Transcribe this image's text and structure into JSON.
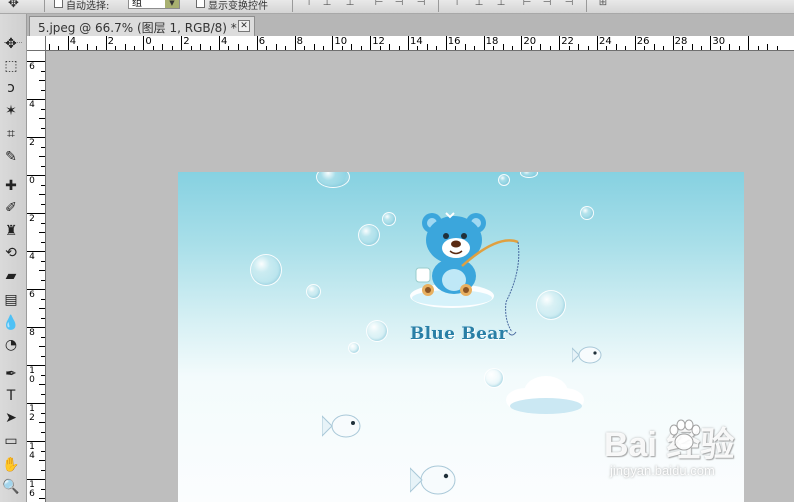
{
  "options_bar": {
    "auto_select_label": "自动选择:",
    "auto_select_value": "组",
    "transform_controls_label": "显示变换控件"
  },
  "document_tab": {
    "title": "5.jpeg @ 66.7% (图层 1, RGB/8) *",
    "close_glyph": "✕"
  },
  "tools": [
    {
      "name": "move-tool-icon",
      "glyph": "✥"
    },
    {
      "name": "marquee-tool-icon",
      "glyph": "⬚"
    },
    {
      "name": "lasso-tool-icon",
      "glyph": "ↄ"
    },
    {
      "name": "magic-wand-tool-icon",
      "glyph": "✶"
    },
    {
      "name": "crop-tool-icon",
      "glyph": "⌗"
    },
    {
      "name": "eyedropper-tool-icon",
      "glyph": "✎"
    },
    {
      "name": "healing-brush-tool-icon",
      "glyph": "✚"
    },
    {
      "name": "brush-tool-icon",
      "glyph": "✐"
    },
    {
      "name": "clone-stamp-tool-icon",
      "glyph": "♜"
    },
    {
      "name": "history-brush-tool-icon",
      "glyph": "⟲"
    },
    {
      "name": "eraser-tool-icon",
      "glyph": "▰"
    },
    {
      "name": "gradient-tool-icon",
      "glyph": "▤"
    },
    {
      "name": "blur-tool-icon",
      "glyph": "💧"
    },
    {
      "name": "dodge-tool-icon",
      "glyph": "◔"
    },
    {
      "name": "pen-tool-icon",
      "glyph": "✒"
    },
    {
      "name": "type-tool-icon",
      "glyph": "T"
    },
    {
      "name": "path-selection-tool-icon",
      "glyph": "➤"
    },
    {
      "name": "rectangle-tool-icon",
      "glyph": "▭"
    },
    {
      "name": "hand-tool-icon",
      "glyph": "✋"
    },
    {
      "name": "zoom-tool-icon",
      "glyph": "🔍"
    }
  ],
  "ruler_h": [
    "6",
    "4",
    "2",
    "0",
    "2",
    "4",
    "6",
    "8",
    "10",
    "12",
    "14",
    "16",
    "18",
    "20",
    "22",
    "24",
    "26",
    "28",
    "30"
  ],
  "ruler_v": [
    "6",
    "4",
    "2",
    "0",
    "2",
    "4",
    "6",
    "8",
    "10",
    "12",
    "14",
    "16"
  ],
  "canvas": {
    "brand_text": "Blue Bear",
    "watermark_main": "Bai 经验",
    "watermark_sub": "jingyan.baidu.com"
  },
  "colors": {
    "sky_top": "#86d1e1",
    "bear_blue": "#3ba6dc",
    "brand_blue": "#2a7fa6"
  }
}
